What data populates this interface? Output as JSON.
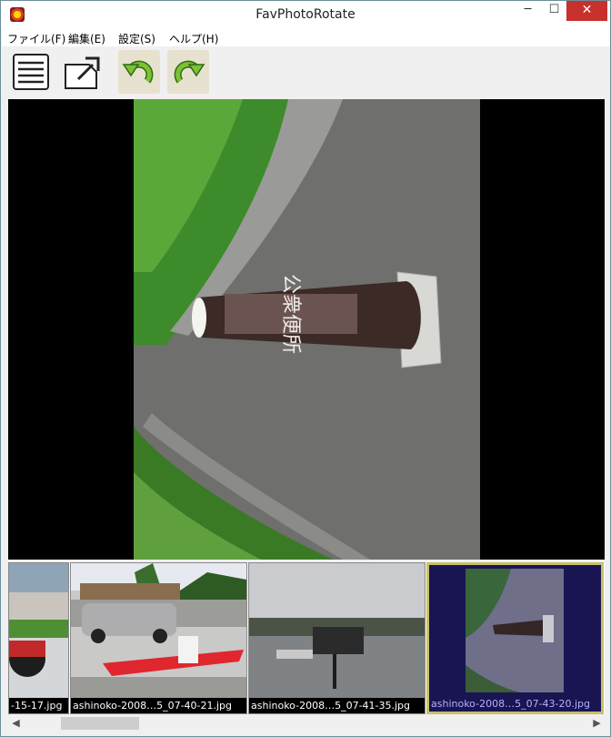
{
  "window": {
    "title": "FavPhotoRotate",
    "controls": {
      "minimize": "─",
      "maximize": "☐",
      "close": "✕"
    }
  },
  "menu": {
    "file": "ファイル(F)",
    "edit": "編集(E)",
    "settings": "設定(S)",
    "help": "ヘルプ(H)"
  },
  "toolbar": {
    "icons": [
      "list-icon",
      "export-icon",
      "rotate-left-icon",
      "rotate-right-icon"
    ],
    "rotate_color": "#7cc232"
  },
  "viewer": {
    "sign_text": "公衆便所"
  },
  "thumbnails": [
    {
      "caption": "-15-17.jpg"
    },
    {
      "caption": "ashinoko-2008…5_07-40-21.jpg"
    },
    {
      "caption": "ashinoko-2008…5_07-41-35.jpg"
    },
    {
      "caption": "ashinoko-2008…5_07-43-20.jpg"
    }
  ],
  "colors": {
    "selected_thumb_bg": "#191552",
    "selected_thumb_border": "#c7c069",
    "selected_caption": "#b5b1ff",
    "close_button": "#c7302b"
  }
}
